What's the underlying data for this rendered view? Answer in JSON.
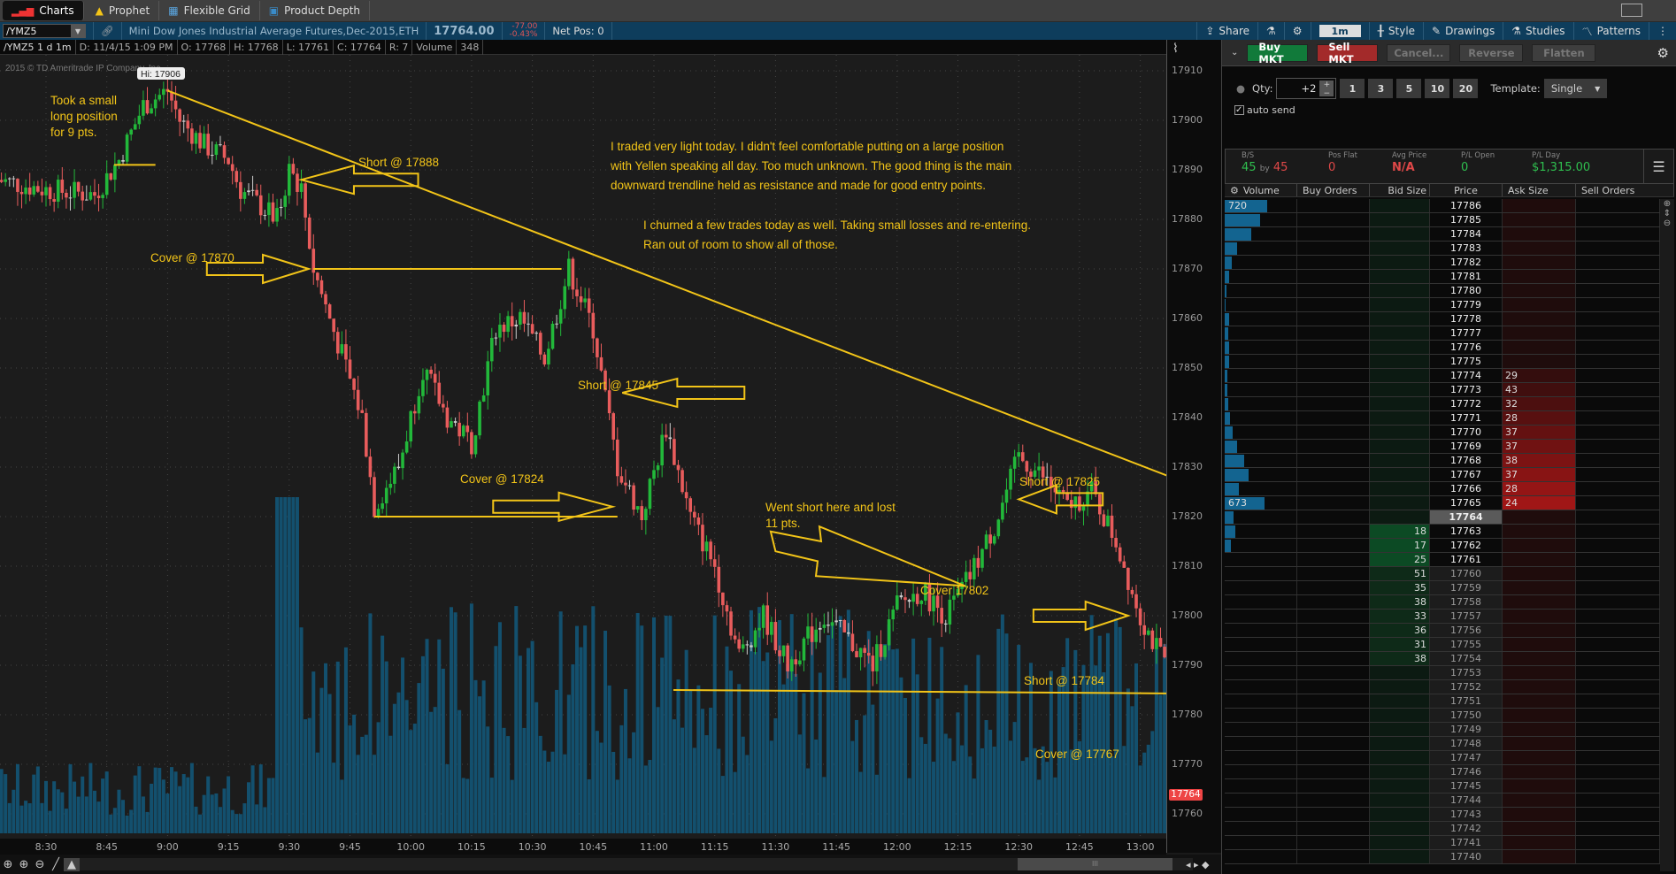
{
  "tabs": [
    {
      "label": "Charts",
      "icon": "bar-chart-icon",
      "active": true
    },
    {
      "label": "Prophet",
      "icon": "prophet-icon"
    },
    {
      "label": "Flexible Grid",
      "icon": "grid-icon"
    },
    {
      "label": "Product Depth",
      "icon": "depth-icon"
    }
  ],
  "symbol": {
    "value": "/YMZ5",
    "description": "Mini Dow Jones Industrial Average Futures,Dec-2015,ETH",
    "last": "17764.00",
    "change": "-77.00",
    "change_pct": "-0.43%",
    "net_pos": "Net Pos: 0"
  },
  "toolbar": {
    "share": "Share",
    "timeframe": "1m",
    "style": "Style",
    "drawings": "Drawings",
    "studies": "Studies",
    "patterns": "Patterns"
  },
  "infobar": {
    "title": "/YMZ5 1 d 1m",
    "date": "D: 11/4/15 1:09 PM",
    "open": "O: 17768",
    "high": "H: 17768",
    "low": "L: 17761",
    "close": "C: 17764",
    "range": "R: 7",
    "volume_label": "Volume",
    "volume": "348"
  },
  "chart_data": {
    "type": "candlestick",
    "copyright": "2015 © TD Ameritrade IP Company, Inc.",
    "hi_label": "Hi: 17906",
    "ylim": [
      17757,
      17914
    ],
    "yticks": [
      17910,
      17900,
      17890,
      17880,
      17870,
      17860,
      17850,
      17840,
      17830,
      17820,
      17810,
      17800,
      17790,
      17780,
      17770,
      17760
    ],
    "xticks": [
      "8:30",
      "8:45",
      "9:00",
      "9:15",
      "9:30",
      "9:45",
      "10:00",
      "10:15",
      "10:30",
      "10:45",
      "11:00",
      "11:15",
      "11:30",
      "11:45",
      "12:00",
      "12:15",
      "12:30",
      "12:45",
      "13:00"
    ],
    "current_price": "17764",
    "price_path": [
      [
        8.3,
        17888
      ],
      [
        8.5,
        17886
      ],
      [
        8.7,
        17885
      ],
      [
        8.8,
        17892
      ],
      [
        8.9,
        17903
      ],
      [
        9.0,
        17906
      ],
      [
        9.05,
        17900
      ],
      [
        9.15,
        17895
      ],
      [
        9.25,
        17892
      ],
      [
        9.3,
        17886
      ],
      [
        9.45,
        17880
      ],
      [
        9.5,
        17890
      ],
      [
        9.55,
        17886
      ],
      [
        9.6,
        17870
      ],
      [
        9.7,
        17855
      ],
      [
        9.8,
        17840
      ],
      [
        9.85,
        17822
      ],
      [
        9.95,
        17830
      ],
      [
        10.05,
        17850
      ],
      [
        10.15,
        17840
      ],
      [
        10.25,
        17835
      ],
      [
        10.35,
        17858
      ],
      [
        10.45,
        17860
      ],
      [
        10.55,
        17852
      ],
      [
        10.65,
        17870
      ],
      [
        10.75,
        17858
      ],
      [
        10.85,
        17830
      ],
      [
        10.95,
        17820
      ],
      [
        11.05,
        17838
      ],
      [
        11.15,
        17820
      ],
      [
        11.25,
        17810
      ],
      [
        11.35,
        17792
      ],
      [
        11.45,
        17800
      ],
      [
        11.55,
        17790
      ],
      [
        11.7,
        17800
      ],
      [
        11.8,
        17795
      ],
      [
        11.9,
        17790
      ],
      [
        12.0,
        17802
      ],
      [
        12.1,
        17805
      ],
      [
        12.2,
        17800
      ],
      [
        12.3,
        17808
      ],
      [
        12.4,
        17818
      ],
      [
        12.5,
        17832
      ],
      [
        12.6,
        17828
      ],
      [
        12.7,
        17822
      ],
      [
        12.8,
        17825
      ],
      [
        12.9,
        17815
      ],
      [
        13.0,
        17800
      ],
      [
        13.1,
        17790
      ],
      [
        13.2,
        17798
      ],
      [
        13.3,
        17790
      ],
      [
        13.4,
        17792
      ],
      [
        13.5,
        17798
      ],
      [
        13.6,
        17785
      ],
      [
        13.7,
        17775
      ],
      [
        13.8,
        17766
      ],
      [
        13.9,
        17764
      ]
    ],
    "annotations": [
      {
        "text": "Took a small long position for 9 pts.",
        "lines": [
          "Took a small",
          "long position",
          "for 9 pts."
        ]
      },
      {
        "text": "Short @ 17888"
      },
      {
        "text": "Cover @ 17870"
      },
      {
        "text": "Short @ 17845"
      },
      {
        "text": "Cover @ 17824"
      },
      {
        "text": "Went short here and lost 11 pts.",
        "lines": [
          "Went short here and lost",
          "11 pts."
        ]
      },
      {
        "text": "Cover 17802"
      },
      {
        "text": "Short @ 17825"
      },
      {
        "text": "Short @ 17784"
      },
      {
        "text": "Cover @ 17767"
      }
    ],
    "notes": [
      "I traded very light today.  I didn't feel comfortable putting on a large position",
      "with Yellen speaking all day.  Too much unknown.  The good thing is the main",
      "downward trendline held as resistance and made for good entry points.",
      "I churned a few trades today as well. Taking small losses and re-entering.",
      "Ran out of room to show all of those."
    ],
    "colors": {
      "up": "#22b83a",
      "down": "#e85c5c",
      "volume": "#13506e",
      "annotation": "#f2c418"
    }
  },
  "order": {
    "buy": "Buy MKT",
    "sell": "Sell MKT",
    "cancel": "Cancel...",
    "reverse": "Reverse",
    "flatten": "Flatten",
    "qty_label": "Qty:",
    "qty": "+2",
    "quick_qty": [
      "1",
      "3",
      "5",
      "10",
      "20"
    ],
    "template_label": "Template:",
    "template": "Single",
    "auto_send": "auto send"
  },
  "stats": [
    {
      "label": "B/S",
      "value_a": "45",
      "by": "by",
      "value_b": "45"
    },
    {
      "label": "Pos Flat",
      "value": "0"
    },
    {
      "label": "Avg Price",
      "value": "N/A"
    },
    {
      "label": "P/L Open",
      "value": "0"
    },
    {
      "label": "P/L Day",
      "value": "$1,315.00"
    }
  ],
  "ladder_headers": [
    "Volume",
    "Buy Orders",
    "Bid Size",
    "Price",
    "Ask Size",
    "Sell Orders"
  ],
  "ladder": [
    {
      "price": "17786",
      "vol": "720",
      "vf": 1.0
    },
    {
      "price": "17785",
      "vf": 0.83
    },
    {
      "price": "17784",
      "vf": 0.63
    },
    {
      "price": "17783",
      "vf": 0.3
    },
    {
      "price": "17782",
      "vf": 0.17
    },
    {
      "price": "17781",
      "vf": 0.1
    },
    {
      "price": "17780",
      "vf": 0.05
    },
    {
      "price": "17779",
      "vf": 0.03
    },
    {
      "price": "17778",
      "vf": 0.1
    },
    {
      "price": "17777",
      "vf": 0.08
    },
    {
      "price": "17776",
      "vf": 0.1
    },
    {
      "price": "17775",
      "vf": 0.1
    },
    {
      "price": "17774",
      "vf": 0.06,
      "ask": "29"
    },
    {
      "price": "17773",
      "vf": 0.07,
      "ask": "43"
    },
    {
      "price": "17772",
      "vf": 0.09,
      "ask": "32"
    },
    {
      "price": "17771",
      "vf": 0.13,
      "ask": "28"
    },
    {
      "price": "17770",
      "vf": 0.19,
      "ask": "37"
    },
    {
      "price": "17769",
      "vf": 0.29,
      "ask": "37"
    },
    {
      "price": "17768",
      "vf": 0.45,
      "ask": "38"
    },
    {
      "price": "17767",
      "vf": 0.56,
      "ask": "37"
    },
    {
      "price": "17766",
      "vf": 0.33,
      "ask": "28"
    },
    {
      "price": "17765",
      "vol": "673",
      "vf": 0.93,
      "ask": "24"
    },
    {
      "price": "17764",
      "vf": 0.21,
      "current": true
    },
    {
      "price": "17763",
      "vf": 0.25,
      "bid": "18"
    },
    {
      "price": "17762",
      "vf": 0.15,
      "bid": "17"
    },
    {
      "price": "17761",
      "bid": "25"
    },
    {
      "price": "17760",
      "bid": "51"
    },
    {
      "price": "17759",
      "bid": "35"
    },
    {
      "price": "17758",
      "bid": "38"
    },
    {
      "price": "17757",
      "bid": "33"
    },
    {
      "price": "17756",
      "bid": "36"
    },
    {
      "price": "17755",
      "bid": "31"
    },
    {
      "price": "17754",
      "bid": "38"
    },
    {
      "price": "17753"
    },
    {
      "price": "17752"
    },
    {
      "price": "17751"
    },
    {
      "price": "17750"
    },
    {
      "price": "17749"
    },
    {
      "price": "17748"
    },
    {
      "price": "17747"
    },
    {
      "price": "17746"
    },
    {
      "price": "17745"
    },
    {
      "price": "17744"
    },
    {
      "price": "17743"
    },
    {
      "price": "17742"
    },
    {
      "price": "17741"
    },
    {
      "price": "17740"
    }
  ]
}
